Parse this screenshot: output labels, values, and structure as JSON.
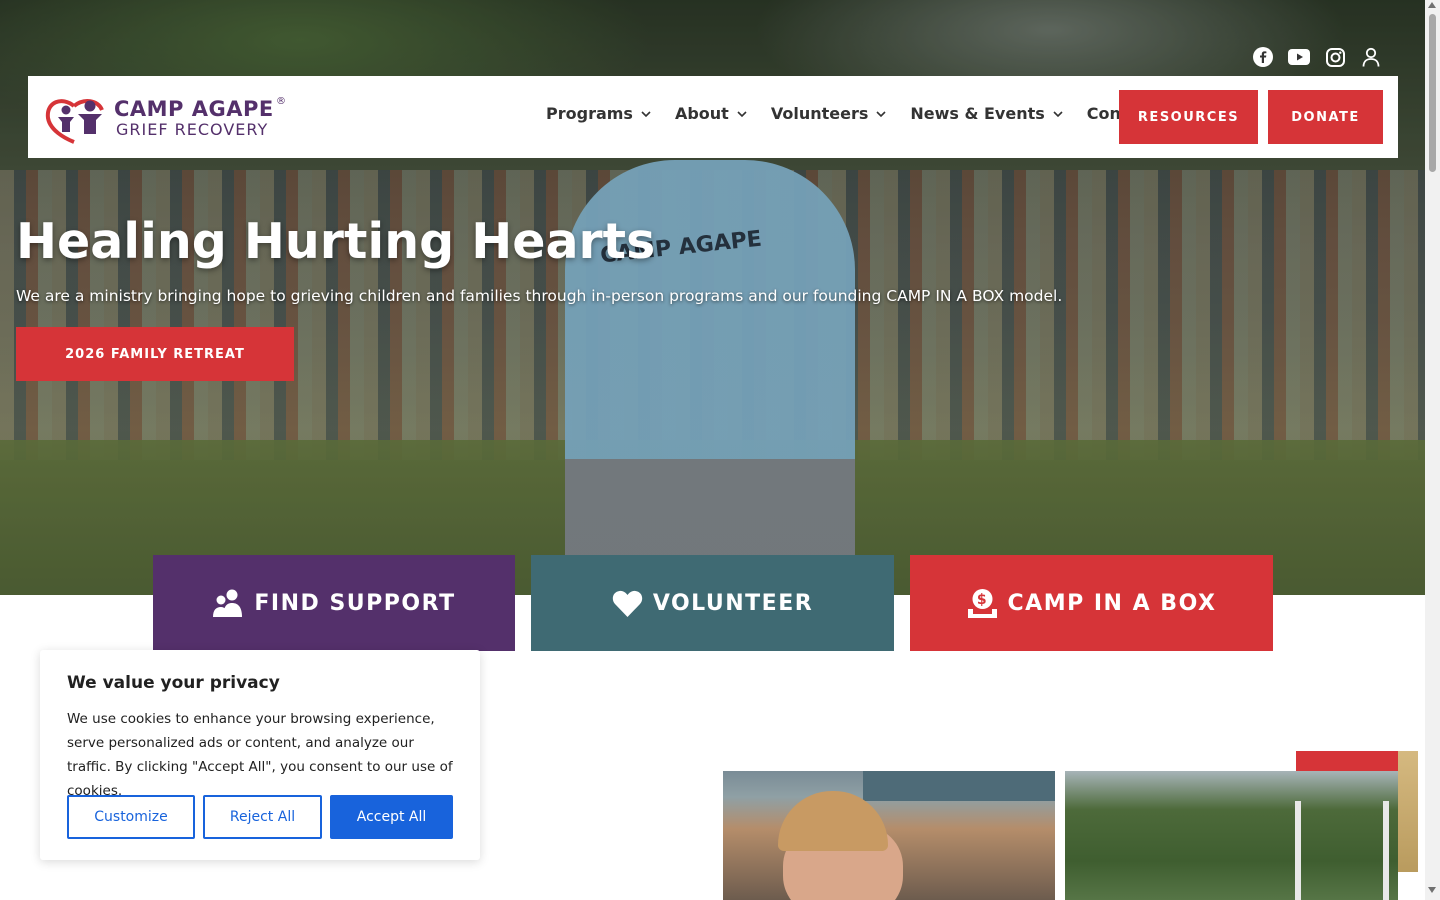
{
  "header": {
    "social_icons": [
      "facebook-icon",
      "youtube-icon",
      "instagram-icon",
      "user-account-icon"
    ],
    "logo": {
      "line1": "CAMP AGAPE",
      "line2": "GRIEF RECOVERY",
      "registered": "®"
    },
    "nav": [
      {
        "label": "Programs"
      },
      {
        "label": "About"
      },
      {
        "label": "Volunteers"
      },
      {
        "label": "News & Events"
      },
      {
        "label": "Contact"
      }
    ],
    "resources_label": "RESOURCES",
    "donate_label": "DONATE"
  },
  "hero": {
    "title": "Healing Hurting Hearts",
    "subtitle": "We are a ministry bringing hope to grieving children and families through in-person programs and our founding CAMP IN A BOX model.",
    "cta_label": "2026 FAMILY RETREAT",
    "shirt_text": "CAMP AGAPE"
  },
  "tiles": [
    {
      "label": "FIND SUPPORT",
      "icon": "people-support-icon",
      "color": "#54306b"
    },
    {
      "label": "VOLUNTEER",
      "icon": "heart-icon",
      "color": "#3f6a73"
    },
    {
      "label": "CAMP IN A BOX",
      "icon": "donation-box-icon",
      "color": "#d63438"
    }
  ],
  "cookie": {
    "title": "We value your privacy",
    "body": "We use cookies to enhance your browsing experience, serve personalized ads or content, and analyze our traffic. By clicking \"Accept All\", you consent to our use of cookies.",
    "customize_label": "Customize",
    "reject_label": "Reject All",
    "accept_label": "Accept All"
  },
  "colors": {
    "brand_purple": "#54306b",
    "brand_red": "#d63438",
    "brand_teal": "#3f6a73",
    "cookie_blue": "#1863dc"
  }
}
